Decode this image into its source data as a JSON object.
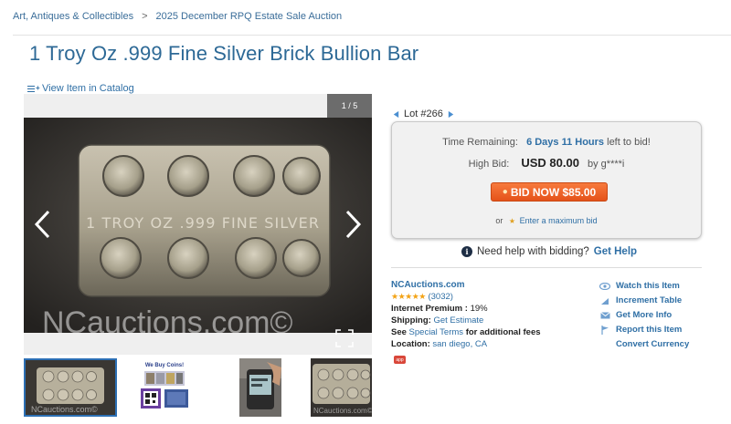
{
  "breadcrumb": {
    "items": [
      "Art, Antiques & Collectibles",
      "2025 December RPQ Estate Sale Auction"
    ],
    "separator": ">"
  },
  "title": "1 Troy Oz .999 Fine Silver Brick Bullion Bar",
  "catalog_link": "View Item in Catalog",
  "viewer": {
    "counter": "1 / 5",
    "bar_inscription": "1 TROY OZ .999 FINE SILVER",
    "watermark": "NCauctions.com©",
    "thumb_watermark": "NCauctions.com©",
    "thumb2_caption": "We Buy Coins!"
  },
  "lot": {
    "label": "Lot #266"
  },
  "bid_box": {
    "time_label": "Time Remaining:",
    "time_value": "6 Days 11 Hours",
    "time_suffix": "left to bid!",
    "high_bid_label": "High Bid:",
    "high_bid_amount": "USD 80.00",
    "high_bid_by": "by g****i",
    "bid_button": "BID NOW $85.00",
    "max_bid_prefix": "or",
    "max_bid_link": "Enter a maximum bid"
  },
  "help": {
    "text": "Need help with bidding?",
    "link": "Get Help"
  },
  "seller": {
    "name": "NCAuctions.com",
    "rating_count": "(3032)",
    "premium_label": "Internet Premium :",
    "premium_value": "19%",
    "shipping_label": "Shipping:",
    "shipping_link": "Get Estimate",
    "see_label": "See",
    "terms_link": "Special Terms",
    "terms_suffix": "for additional fees",
    "location_label": "Location:",
    "location_value": "san diego, CA",
    "badge": "app"
  },
  "actions": [
    "Watch this Item",
    "Increment Table",
    "Get More Info",
    "Report this Item",
    "Convert Currency"
  ],
  "colors": {
    "link": "#2f6fa5",
    "title": "#2d6996",
    "bid_button": "#ef6a2e",
    "stars": "#f3a316"
  }
}
